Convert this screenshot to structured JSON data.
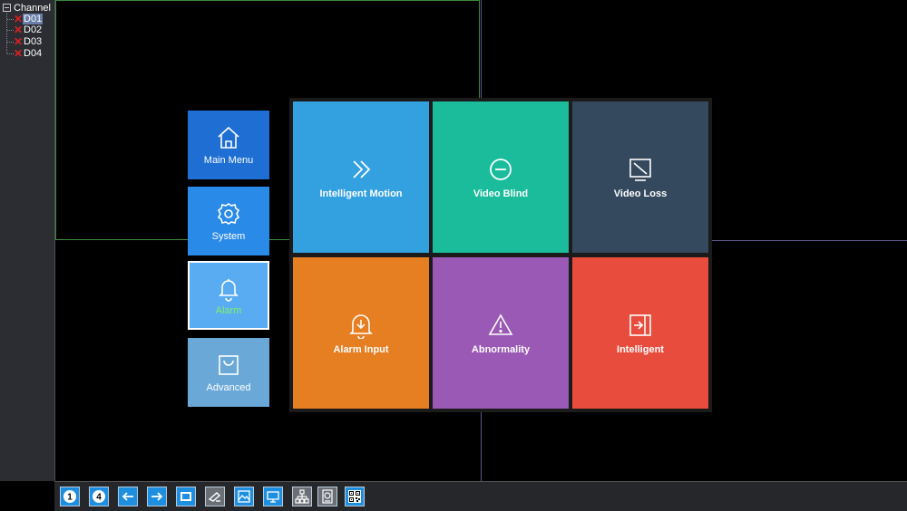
{
  "channel_tree": {
    "title": "Channel",
    "channels": [
      {
        "label": "D01",
        "selected": true
      },
      {
        "label": "D02",
        "selected": false
      },
      {
        "label": "D03",
        "selected": false
      },
      {
        "label": "D04",
        "selected": false
      }
    ]
  },
  "side_menu": [
    {
      "label": "Main Menu",
      "icon": "home-icon",
      "color": "#1f6ed4"
    },
    {
      "label": "System",
      "icon": "gear-icon",
      "color": "#2a8ae8"
    },
    {
      "label": "Alarm",
      "icon": "bell-icon",
      "color": "#5aacf2",
      "active": true,
      "label_color": "#7ef06a"
    },
    {
      "label": "Advanced",
      "icon": "bag-icon",
      "color": "#6aa8d8"
    }
  ],
  "alarm_tiles": [
    {
      "label": "Intelligent Motion",
      "icon": "double-chevron-right-icon",
      "color": "#33a0e0"
    },
    {
      "label": "Video Blind",
      "icon": "minus-circle-icon",
      "color": "#1abc9c"
    },
    {
      "label": "Video Loss",
      "icon": "no-signal-screen-icon",
      "color": "#34495e"
    },
    {
      "label": "Alarm Input",
      "icon": "bell-down-icon",
      "color": "#e67e22"
    },
    {
      "label": "Abnormality",
      "icon": "warning-triangle-icon",
      "color": "#9b59b6"
    },
    {
      "label": "Intelligent",
      "icon": "login-arrow-icon",
      "color": "#e74c3c"
    }
  ],
  "toolbar": {
    "buttons": [
      {
        "name": "single-view-1",
        "icon": "single-view-icon",
        "label": "1"
      },
      {
        "name": "quad-view-4",
        "icon": "quad-view-icon",
        "label": "4"
      },
      {
        "name": "previous",
        "icon": "arrow-left-icon"
      },
      {
        "name": "next",
        "icon": "arrow-right-icon"
      },
      {
        "name": "record",
        "icon": "record-icon"
      },
      {
        "name": "ptz",
        "icon": "ptz-camera-icon"
      },
      {
        "name": "color-setting",
        "icon": "picture-icon"
      },
      {
        "name": "output-adjust",
        "icon": "monitor-icon"
      },
      {
        "name": "network",
        "icon": "network-icon"
      },
      {
        "name": "hdd",
        "icon": "hdd-icon"
      },
      {
        "name": "qr-code",
        "icon": "qr-code-icon"
      }
    ]
  }
}
